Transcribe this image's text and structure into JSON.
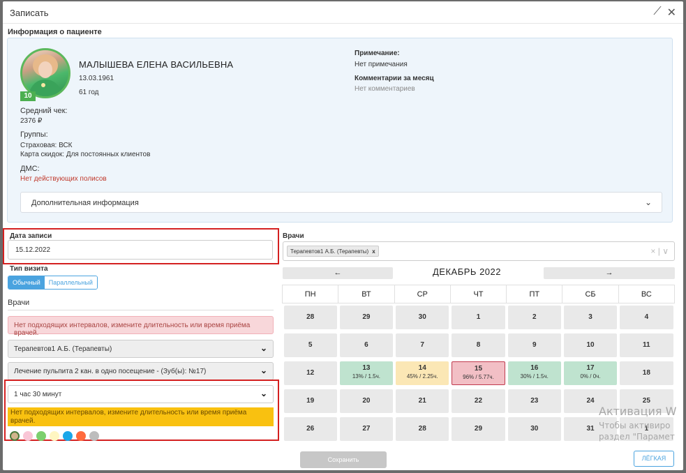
{
  "modal": {
    "title": "Записать"
  },
  "patient_section": {
    "heading": "Информация о пациенте",
    "name": "МАЛЫШЕВА ЕЛЕНА ВАСИЛЬЕВНА",
    "dob": "13.03.1961",
    "age": "61 год",
    "avatar_badge": "10",
    "avg_check_label": "Средний чек:",
    "avg_check_value": "2376 ₽",
    "groups_label": "Группы:",
    "groups": [
      "Страховая: ВСК",
      "Карта скидок: Для постоянных клиентов"
    ],
    "dms_label": "ДМС:",
    "dms_value": "Нет действующих полисов",
    "note_label": "Примечание:",
    "note_value": "Нет примечания",
    "comments_label": "Комментарии за месяц",
    "comments_value": "Нет комментариев",
    "more_info": "Дополнительная информация"
  },
  "appointment": {
    "date_label": "Дата записи",
    "date_value": "15.12.2022",
    "visit_type_label": "Тип визита",
    "visit_types": [
      "Обычный",
      "Параллельный"
    ],
    "doctors_label": "Врачи",
    "alert_no_intervals": "Нет подходящих интервалов, измените длительность или время приёма врачей.",
    "doctor_select": "Терапевтов1 А.Б. (Терапевты)",
    "service_select": "Лечение пульпита 2 кан. в одно посещение - (Зуб(ы): №17)",
    "duration_select": "1 час 30 минут",
    "alert_yellow": "Нет подходящих интервалов, измените длительность или время приёма врачей.",
    "color_dots": [
      "#d2b48c",
      "#f9c6d6",
      "#7ccf6e",
      "#fff6c2",
      "#1ba7e9",
      "#ff6a3d",
      "#bdbdbd"
    ]
  },
  "doctors_panel": {
    "label": "Врачи",
    "tag": "Терапевтов1 А.Б. (Терапевты)",
    "tag_remove": "x",
    "actions": "× | ∨"
  },
  "calendar": {
    "prev": "←",
    "next": "→",
    "title": "ДЕКАБРЬ 2022",
    "weekdays": [
      "ПН",
      "ВТ",
      "СР",
      "ЧТ",
      "ПТ",
      "СБ",
      "ВС"
    ],
    "weeks": [
      [
        {
          "d": "28"
        },
        {
          "d": "29"
        },
        {
          "d": "30"
        },
        {
          "d": "1"
        },
        {
          "d": "2"
        },
        {
          "d": "3"
        },
        {
          "d": "4"
        }
      ],
      [
        {
          "d": "5"
        },
        {
          "d": "6"
        },
        {
          "d": "7"
        },
        {
          "d": "8"
        },
        {
          "d": "9"
        },
        {
          "d": "10"
        },
        {
          "d": "11"
        }
      ],
      [
        {
          "d": "12"
        },
        {
          "d": "13",
          "sub": "13% / 1.5ч.",
          "c": "green"
        },
        {
          "d": "14",
          "sub": "45% / 2.25ч.",
          "c": "yellow"
        },
        {
          "d": "15",
          "sub": "96% / 5.77ч.",
          "c": "red"
        },
        {
          "d": "16",
          "sub": "30% / 1.5ч.",
          "c": "green"
        },
        {
          "d": "17",
          "sub": "0% / 0ч.",
          "c": "green"
        },
        {
          "d": "18"
        }
      ],
      [
        {
          "d": "19"
        },
        {
          "d": "20"
        },
        {
          "d": "21"
        },
        {
          "d": "22"
        },
        {
          "d": "23"
        },
        {
          "d": "24"
        },
        {
          "d": "25"
        }
      ],
      [
        {
          "d": "26"
        },
        {
          "d": "27"
        },
        {
          "d": "28"
        },
        {
          "d": "29"
        },
        {
          "d": "30"
        },
        {
          "d": "31"
        },
        {
          "d": "1"
        }
      ]
    ]
  },
  "watermark": [
    "Активация W",
    "Чтобы активиро",
    "раздел \"Парамет"
  ],
  "footer": {
    "save": "Сохранить",
    "easy": "ЛЁГКАЯ"
  }
}
